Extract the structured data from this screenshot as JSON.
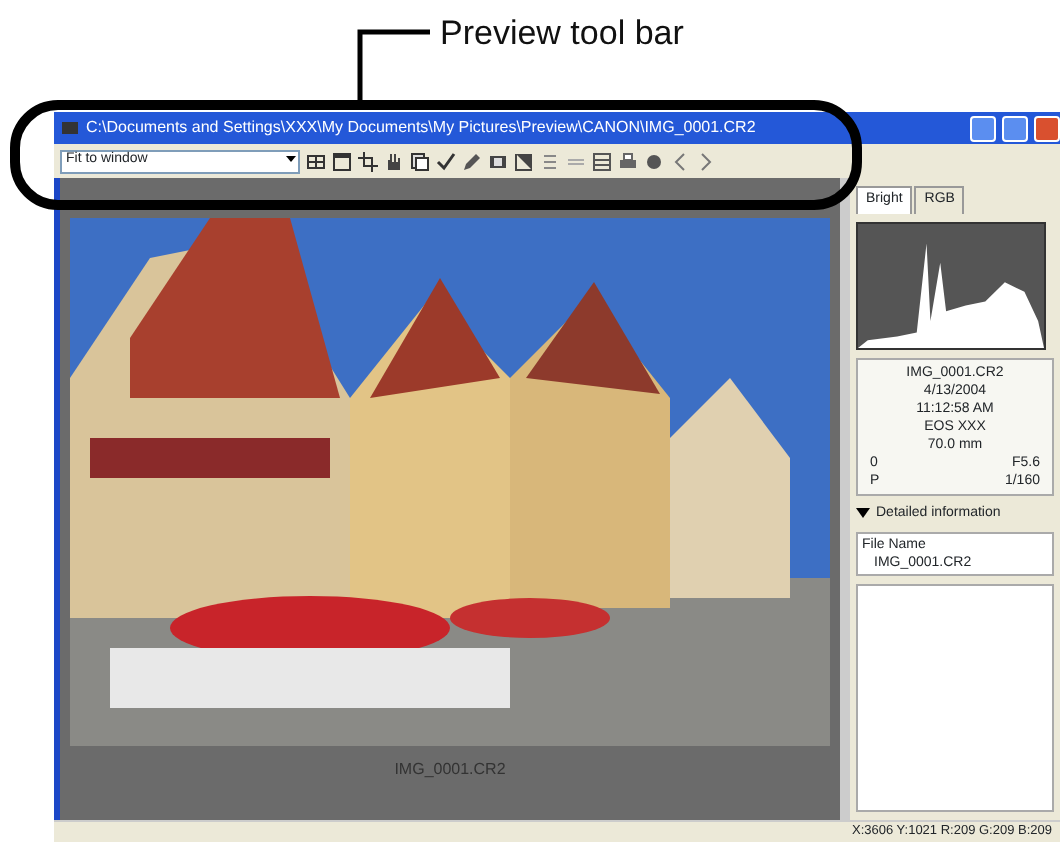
{
  "callout": {
    "label": "Preview tool bar"
  },
  "window": {
    "title": "C:\\Documents and Settings\\XXX\\My Documents\\My Pictures\\Preview\\CANON\\IMG_0001.CR2"
  },
  "toolbar": {
    "zoom": "Fit to window"
  },
  "preview": {
    "caption": "IMG_0001.CR2"
  },
  "side_panel": {
    "tabs": [
      {
        "label": "Bright",
        "selected": true
      },
      {
        "label": "RGB",
        "selected": false
      }
    ],
    "info_lines": [
      "IMG_0001.CR2",
      "4/13/2004",
      "11:12:58 AM",
      "EOS XXX",
      "70.0 mm"
    ],
    "exposure": [
      {
        "label": "0",
        "value": "F5.6"
      },
      {
        "label": "P",
        "value": "1/160"
      }
    ],
    "details": {
      "title": "Detailed information",
      "expanded": true,
      "field": "File Name",
      "value": "IMG_0001.CR2"
    }
  },
  "status_bar": "X:3606 Y:1021 R:209 G:209 B:209"
}
